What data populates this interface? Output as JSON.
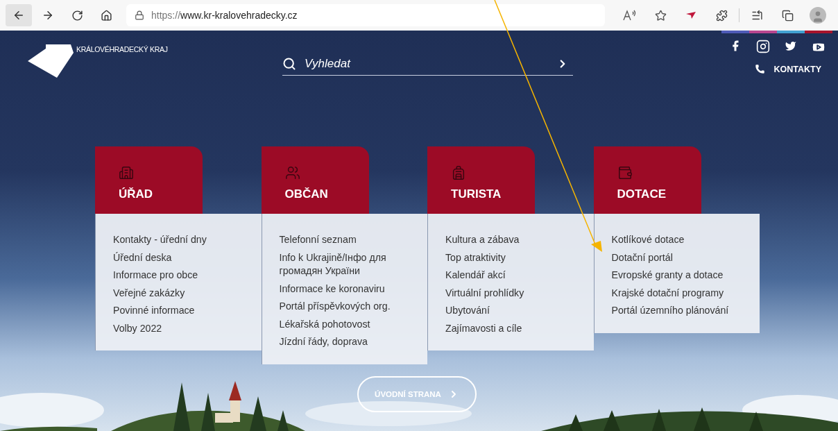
{
  "browser": {
    "url_scheme": "https://",
    "url_host": "www.kr-kralovehradecky.cz"
  },
  "site": {
    "logo_text": "KRÁLOVÉHRADECKÝ KRAJ",
    "search": {
      "placeholder": "Vyhledat"
    },
    "social": [
      {
        "kind": "facebook",
        "color": "#4f5bb8"
      },
      {
        "kind": "instagram",
        "color": "#b8468f"
      },
      {
        "kind": "twitter",
        "color": "#42a2d2"
      },
      {
        "kind": "youtube",
        "color": "#a8142c"
      }
    ],
    "contacts": "KONTAKTY",
    "categories": [
      {
        "title": "ÚŘAD",
        "kind": "building",
        "items": [
          "Kontakty - úřední dny",
          "Úřední deska",
          "Informace pro obce",
          "Veřejné zakázky",
          "Povinné informace",
          "Volby 2022"
        ]
      },
      {
        "title": "OBČAN",
        "kind": "people",
        "items": [
          "Telefonní seznam",
          "Info k Ukrajině/Інфо для громадян України",
          "Informace ke koronaviru",
          "Portál příspěvkových org.",
          "Lékařská pohotovost",
          "Jízdní řády, doprava"
        ]
      },
      {
        "title": "TURISTA",
        "kind": "backpack",
        "items": [
          "Kultura a zábava",
          "Top atraktivity",
          "Kalendář akcí",
          "Virtuální prohlídky",
          "Ubytování",
          "Zajímavosti a cíle"
        ]
      },
      {
        "title": "DOTACE",
        "kind": "wallet",
        "items": [
          "Kotlíkové dotace",
          "Dotační portál",
          "Evropské granty a dotace",
          "Krajské dotační programy",
          "Portál územního plánování"
        ]
      }
    ],
    "home_button": "ÚVODNÍ STRANA"
  }
}
